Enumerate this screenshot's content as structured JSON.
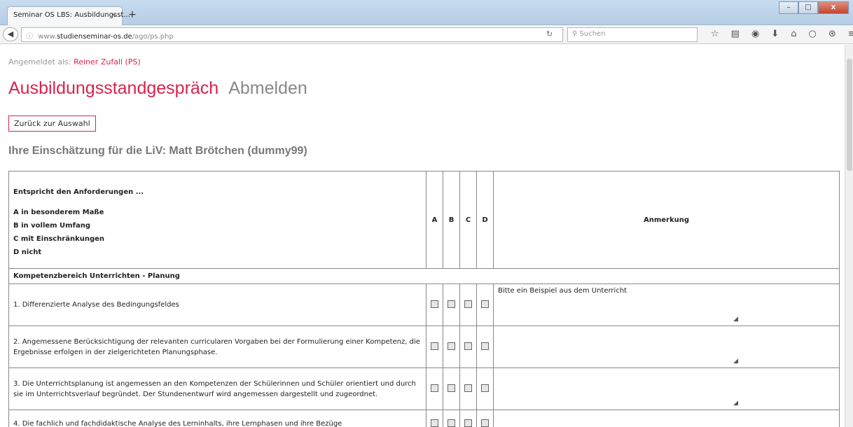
{
  "browser": {
    "tab_title": "Seminar OS LBS: Ausbildungsst...",
    "tab_close": "×",
    "new_tab": "+",
    "url_prefix": "www.",
    "url_host": "studienseminar-os.de",
    "url_path": "/ago/ps.php",
    "search_placeholder": "Suchen",
    "win_min": "–",
    "win_max": "□",
    "win_close": "x"
  },
  "page": {
    "logged_in_label": "Angemeldet als:",
    "logged_in_user": "Reiner Zufall (PS)",
    "title": "Ausbildungsstandgespräch",
    "logout": "Abmelden",
    "back_button": "Zurück zur Auswahl",
    "subtitle": "Ihre Einschätzung für die LiV: Matt Brötchen (dummy99)"
  },
  "table": {
    "header": {
      "title": "Entspricht den Anforderungen ...",
      "levels": [
        "A  in besonderem Maße",
        "B  in vollem Umfang",
        "C  mit Einschränkungen",
        "D  nicht"
      ],
      "cols": [
        "A",
        "B",
        "C",
        "D"
      ],
      "remark": "Anmerkung"
    },
    "section": "Kompetenzbereich Unterrichten - Planung",
    "rows": [
      {
        "text": "1. Differenzierte Analyse des Bedingungsfeldes",
        "note": "Bitte ein Beispiel aus dem Unterricht"
      },
      {
        "text": "2. Angemessene Berücksichtigung der relevanten curricularen Vorgaben bei der Formulierung einer Kompetenz, die Ergebnisse erfolgen in der zielgerichteten Planungsphase.",
        "note": ""
      },
      {
        "text": "3. Die Unterrichtsplanung ist angemessen an den Kompetenzen der Schülerinnen und Schüler orientiert und durch sie im Unterrichtsverlauf begründet. Der Stundenentwurf wird angemessen dargestellt und zugeordnet.",
        "note": ""
      },
      {
        "text": "4. Die fachlich und fachdidaktische Analyse des Lerninhalts, ihre Lernphasen und ihre Bezüge",
        "note": ""
      }
    ]
  }
}
